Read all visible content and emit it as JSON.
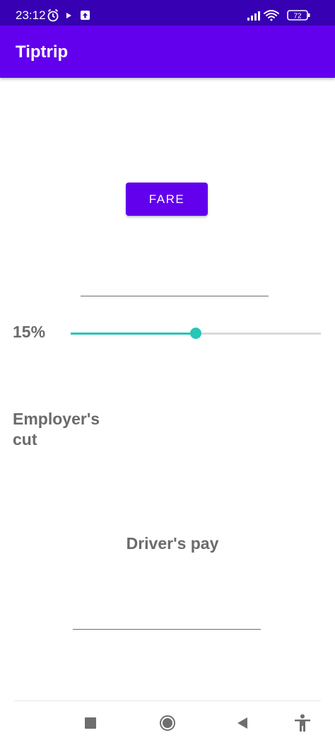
{
  "status_bar": {
    "time": "23:12",
    "battery": "72",
    "icons": [
      "alarm-icon",
      "play-icon",
      "upload-icon",
      "signal-icon",
      "wifi-icon",
      "battery-icon"
    ]
  },
  "app_bar": {
    "title": "Tiptrip"
  },
  "main": {
    "fare_button_label": "FARE",
    "tip_percent": "15%",
    "tip_slider_fraction": 0.5,
    "employer_label": "Employer's cut",
    "driver_label": "Driver's pay"
  },
  "nav_bar": {
    "icons": [
      "recents-square-icon",
      "home-circle-icon",
      "back-triangle-icon",
      "accessibility-icon"
    ]
  },
  "colors": {
    "status_bar": "#3700b3",
    "primary": "#6200ee",
    "slider_accent": "#26c6b8",
    "label_text": "#6b6b6b"
  }
}
